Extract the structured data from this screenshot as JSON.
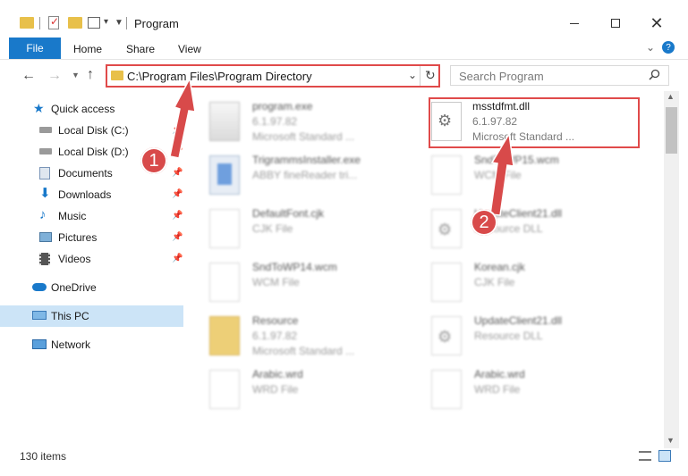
{
  "window": {
    "title": "Program"
  },
  "ribbon": {
    "tabs": [
      "File",
      "Home",
      "Share",
      "View"
    ]
  },
  "address": {
    "path": "C:\\Program Files\\Program Directory"
  },
  "search": {
    "placeholder": "Search Program"
  },
  "nav": {
    "items": [
      {
        "label": "Quick access",
        "icon": "star-icon"
      },
      {
        "label": "Local Disk (C:)",
        "icon": "drive-icon"
      },
      {
        "label": "Local Disk (D:)",
        "icon": "drive-icon"
      },
      {
        "label": "Documents",
        "icon": "documents-icon"
      },
      {
        "label": "Downloads",
        "icon": "download-icon"
      },
      {
        "label": "Music",
        "icon": "music-icon"
      },
      {
        "label": "Pictures",
        "icon": "pictures-icon"
      },
      {
        "label": "Videos",
        "icon": "videos-icon"
      },
      {
        "label": "OneDrive",
        "icon": "cloud-icon"
      },
      {
        "label": "This PC",
        "icon": "computer-icon"
      },
      {
        "label": "Network",
        "icon": "network-icon"
      }
    ]
  },
  "files": [
    {
      "name": "program.exe",
      "line2": "6.1.97.82",
      "line3": "Microsoft Standard ..."
    },
    {
      "name": "msstdfmt.dll",
      "line2": "6.1.97.82",
      "line3": "Microsoft Standard ..."
    },
    {
      "name": "TrigrammsInstaller.exe",
      "line2": "ABBY fineReader tri..."
    },
    {
      "name": "SndToWP15.wcm",
      "line2": "WCM File"
    },
    {
      "name": "DefaultFont.cjk",
      "line2": "CJK File"
    },
    {
      "name": "UpdateClient21.dll",
      "line2": "Resource DLL"
    },
    {
      "name": "SndToWP14.wcm",
      "line2": "WCM File"
    },
    {
      "name": "Korean.cjk",
      "line2": "CJK File"
    },
    {
      "name": "Resource",
      "line2": "6.1.97.82",
      "line3": "Microsoft Standard ..."
    },
    {
      "name": "UpdateClient21.dll",
      "line2": "Resource DLL"
    },
    {
      "name": "Arabic.wrd",
      "line2": "WRD File"
    },
    {
      "name": "Arabic.wrd",
      "line2": "WRD File"
    }
  ],
  "status": {
    "count": "130 items"
  },
  "annotations": {
    "step1": "1",
    "step2": "2"
  },
  "colors": {
    "accent": "#1979ca",
    "highlight": "#e04a4a",
    "badge": "#d84a4a"
  }
}
